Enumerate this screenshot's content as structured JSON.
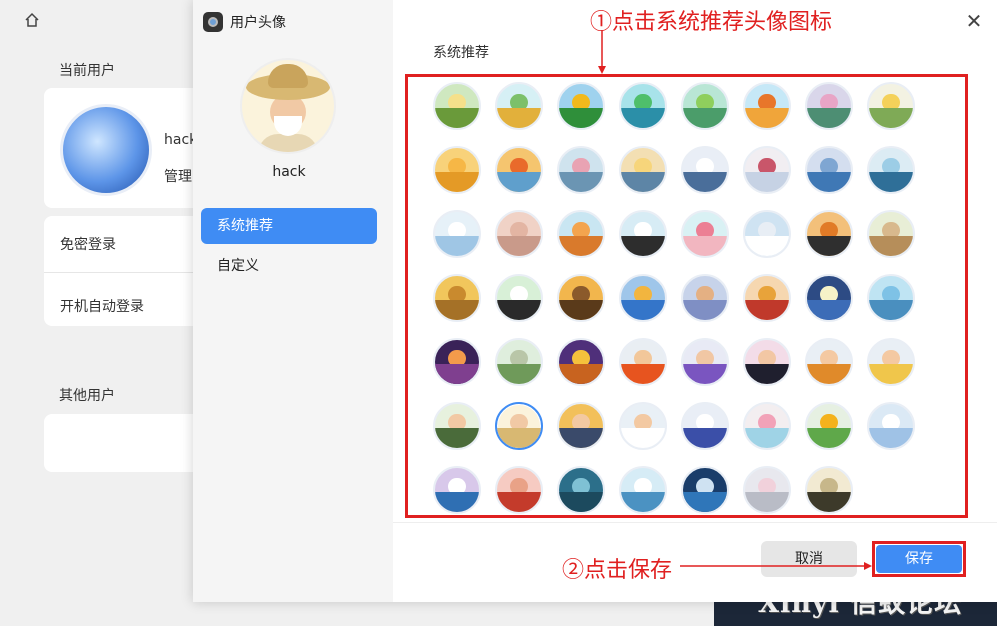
{
  "background": {
    "current_user_heading": "当前用户",
    "user_name": "hack",
    "user_role": "管理",
    "passwordless_login": "免密登录",
    "auto_login": "开机自动登录",
    "other_users_heading": "其他用户"
  },
  "dialog": {
    "title": "用户头像",
    "username": "hack",
    "nav": [
      "系统推荐",
      "自定义"
    ],
    "content_title": "系统推荐",
    "cancel_label": "取消",
    "save_label": "保存",
    "close_icon": "close-icon"
  },
  "annotations": {
    "step1": "①点击系统推荐头像图标",
    "step2": "②点击保存"
  },
  "watermark": "Xinyi 信蚁论坛",
  "avatars": [
    {
      "name": "avatar-1",
      "top": "#cfe8c0",
      "bottom": "#6a9a3a",
      "dot": "#f5e08a"
    },
    {
      "name": "avatar-2",
      "top": "#d6f0f5",
      "bottom": "#e2b03b",
      "dot": "#7cc06a"
    },
    {
      "name": "avatar-3",
      "top": "#9fd2ee",
      "bottom": "#2f8f3a",
      "dot": "#f2b91c"
    },
    {
      "name": "avatar-4",
      "top": "#a8e3ea",
      "bottom": "#2b8fa8",
      "dot": "#4fbf6b"
    },
    {
      "name": "avatar-5",
      "top": "#b9e6d5",
      "bottom": "#4b9d6a",
      "dot": "#8fcf5d"
    },
    {
      "name": "avatar-6",
      "top": "#c6e8f7",
      "bottom": "#f0a53a",
      "dot": "#e8762a"
    },
    {
      "name": "avatar-7",
      "top": "#d9d6ea",
      "bottom": "#4d8e73",
      "dot": "#e8a5c6"
    },
    {
      "name": "avatar-8",
      "top": "#f3f2e2",
      "bottom": "#7faa56",
      "dot": "#f4d15a"
    },
    {
      "name": "avatar-9",
      "top": "#f8d27a",
      "bottom": "#e49a26",
      "dot": "#f6b746"
    },
    {
      "name": "avatar-10",
      "top": "#f5c56f",
      "bottom": "#5f9fcc",
      "dot": "#e96a2b"
    },
    {
      "name": "avatar-11",
      "top": "#cfe3ee",
      "bottom": "#6b95b3",
      "dot": "#e9a3b3"
    },
    {
      "name": "avatar-12",
      "top": "#f3dfb3",
      "bottom": "#5d85a6",
      "dot": "#f7d57b"
    },
    {
      "name": "avatar-13",
      "top": "#e9eef6",
      "bottom": "#4a6e9a",
      "dot": "#ffffff"
    },
    {
      "name": "avatar-14",
      "top": "#f1eef2",
      "bottom": "#c6d2e4",
      "dot": "#c9566a"
    },
    {
      "name": "avatar-15",
      "top": "#d4deef",
      "bottom": "#3f78b5",
      "dot": "#7fa6d2"
    },
    {
      "name": "avatar-16",
      "top": "#dcecf4",
      "bottom": "#2f6f98",
      "dot": "#9ccde6"
    },
    {
      "name": "avatar-17",
      "top": "#e6f1f8",
      "bottom": "#9fc6e5",
      "dot": "#ffffff"
    },
    {
      "name": "avatar-18",
      "top": "#f0d2c6",
      "bottom": "#c99a8a",
      "dot": "#e3b5a3"
    },
    {
      "name": "avatar-19",
      "top": "#c9e6f2",
      "bottom": "#d97a2c",
      "dot": "#f3a44e"
    },
    {
      "name": "avatar-20",
      "top": "#d7ecf5",
      "bottom": "#2d2d2d",
      "dot": "#ffffff"
    },
    {
      "name": "avatar-21",
      "top": "#d9f1f4",
      "bottom": "#f2b6c0",
      "dot": "#ec7f94"
    },
    {
      "name": "avatar-22",
      "top": "#cfe3f2",
      "bottom": "#ffffff",
      "dot": "#e8eef5"
    },
    {
      "name": "avatar-23",
      "top": "#f3c07a",
      "bottom": "#2f2f2f",
      "dot": "#e17b27"
    },
    {
      "name": "avatar-24",
      "top": "#e8eed6",
      "bottom": "#b68e5a",
      "dot": "#d8b98d"
    },
    {
      "name": "avatar-25",
      "top": "#f1c65c",
      "bottom": "#a57127",
      "dot": "#c98a2e"
    },
    {
      "name": "avatar-26",
      "top": "#d8f0d7",
      "bottom": "#2a2a2a",
      "dot": "#ffffff"
    },
    {
      "name": "avatar-27",
      "top": "#f2b64d",
      "bottom": "#5a3a1a",
      "dot": "#8b5a2b"
    },
    {
      "name": "avatar-28",
      "top": "#9fc6ea",
      "bottom": "#3475c9",
      "dot": "#f2b53f"
    },
    {
      "name": "avatar-29",
      "top": "#c7d3ea",
      "bottom": "#7f8fc4",
      "dot": "#e4b083"
    },
    {
      "name": "avatar-30",
      "top": "#f6d7b0",
      "bottom": "#c0392b",
      "dot": "#e8a33a"
    },
    {
      "name": "avatar-31",
      "top": "#2d4b84",
      "bottom": "#3c6cb7",
      "dot": "#f5f2c8"
    },
    {
      "name": "avatar-32",
      "top": "#bfe4f3",
      "bottom": "#4a8fbf",
      "dot": "#7ec2e6"
    },
    {
      "name": "avatar-33",
      "top": "#3a2258",
      "bottom": "#7f3f8f",
      "dot": "#f39b4b"
    },
    {
      "name": "avatar-34",
      "top": "#dfeedd",
      "bottom": "#6f9a5a",
      "dot": "#b9c6a8"
    },
    {
      "name": "avatar-35",
      "top": "#4f2f7a",
      "bottom": "#c8631f",
      "dot": "#f5c13c"
    },
    {
      "name": "avatar-36",
      "top": "#e9eef3",
      "bottom": "#e7541f",
      "dot": "#f2c79a"
    },
    {
      "name": "avatar-37",
      "top": "#e8eaf5",
      "bottom": "#7a55c0",
      "dot": "#f1c7a4"
    },
    {
      "name": "avatar-38",
      "top": "#f3dce8",
      "bottom": "#1f1f2e",
      "dot": "#f2c7a4"
    },
    {
      "name": "avatar-39",
      "top": "#e9eff5",
      "bottom": "#e08a2a",
      "dot": "#f4c9a2"
    },
    {
      "name": "avatar-40",
      "top": "#e9eff5",
      "bottom": "#f0c64b",
      "dot": "#f4c9a2"
    },
    {
      "name": "avatar-41",
      "top": "#e7f1de",
      "bottom": "#4a6b3a",
      "dot": "#f2c9a4"
    },
    {
      "name": "avatar-42",
      "top": "#fbf3dc",
      "bottom": "#d8b872",
      "dot": "#f1c9a5"
    },
    {
      "name": "avatar-43",
      "top": "#f2c05a",
      "bottom": "#3a4a6a",
      "dot": "#f3c9a2"
    },
    {
      "name": "avatar-44",
      "top": "#e9f0f6",
      "bottom": "#ffffff",
      "dot": "#f3c9a2"
    },
    {
      "name": "avatar-45",
      "top": "#e9eef6",
      "bottom": "#3b4fa8",
      "dot": "#ffffff"
    },
    {
      "name": "avatar-46",
      "top": "#f3eef0",
      "bottom": "#9fd3e6",
      "dot": "#f2a2b8"
    },
    {
      "name": "avatar-47",
      "top": "#e6f0e2",
      "bottom": "#5fa84a",
      "dot": "#f4b21d"
    },
    {
      "name": "avatar-48",
      "top": "#dbe9f5",
      "bottom": "#9fc2e6",
      "dot": "#ffffff"
    },
    {
      "name": "avatar-49",
      "top": "#d8c8ea",
      "bottom": "#2f6fb3",
      "dot": "#ffffff"
    },
    {
      "name": "avatar-50",
      "top": "#f6cbc2",
      "bottom": "#c43b2b",
      "dot": "#e9a287"
    },
    {
      "name": "avatar-51",
      "top": "#2c6f8a",
      "bottom": "#1c4a5e",
      "dot": "#7fc1d4"
    },
    {
      "name": "avatar-52",
      "top": "#d6ecf6",
      "bottom": "#4b92c2",
      "dot": "#ffffff"
    },
    {
      "name": "avatar-53",
      "top": "#1a3d6a",
      "bottom": "#2f76b9",
      "dot": "#cfe2f2"
    },
    {
      "name": "avatar-54",
      "top": "#e8e8ee",
      "bottom": "#b9bcc6",
      "dot": "#f1d1db"
    },
    {
      "name": "avatar-55",
      "top": "#f2ead2",
      "bottom": "#3d3a2a",
      "dot": "#c7b78a"
    }
  ]
}
